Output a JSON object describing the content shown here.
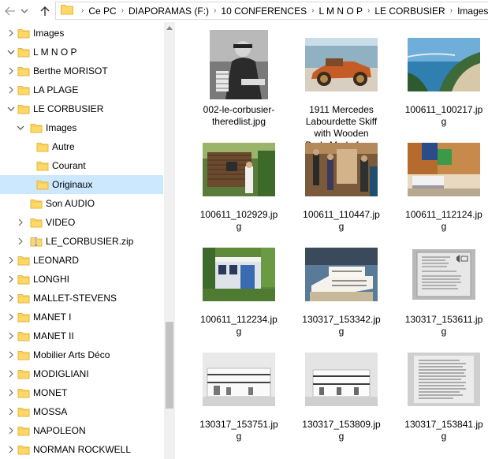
{
  "address": {
    "breadcrumbs": [
      "Ce PC",
      "DIAPORAMAS (F:)",
      "10 CONFERENCES",
      "L M N O P",
      "LE CORBUSIER",
      "Images"
    ]
  },
  "tree": {
    "items": [
      {
        "label": "Images",
        "level": 0,
        "expanded": false,
        "selected": false,
        "type": "folder"
      },
      {
        "label": "L M N O P",
        "level": 0,
        "expanded": true,
        "selected": false,
        "type": "folder"
      },
      {
        "label": "Berthe MORISOT",
        "level": 1,
        "expanded": false,
        "selected": false,
        "type": "folder"
      },
      {
        "label": "LA PLAGE",
        "level": 1,
        "expanded": false,
        "selected": false,
        "type": "folder"
      },
      {
        "label": "LE CORBUSIER",
        "level": 1,
        "expanded": true,
        "selected": false,
        "type": "folder"
      },
      {
        "label": "Images",
        "level": 2,
        "expanded": true,
        "selected": false,
        "type": "folder"
      },
      {
        "label": "Autre",
        "level": 3,
        "expanded": null,
        "selected": false,
        "type": "folder"
      },
      {
        "label": "Courant",
        "level": 3,
        "expanded": null,
        "selected": false,
        "type": "folder"
      },
      {
        "label": "Originaux",
        "level": 3,
        "expanded": null,
        "selected": true,
        "type": "folder"
      },
      {
        "label": "Son AUDIO",
        "level": 2,
        "expanded": null,
        "selected": false,
        "type": "folder"
      },
      {
        "label": "VIDEO",
        "level": 2,
        "expanded": false,
        "selected": false,
        "type": "folder"
      },
      {
        "label": "LE_CORBUSIER.zip",
        "level": 2,
        "expanded": false,
        "selected": false,
        "type": "zip"
      },
      {
        "label": "LEONARD",
        "level": 1,
        "expanded": false,
        "selected": false,
        "type": "folder"
      },
      {
        "label": "LONGHI",
        "level": 1,
        "expanded": false,
        "selected": false,
        "type": "folder"
      },
      {
        "label": "MALLET-STEVENS",
        "level": 1,
        "expanded": false,
        "selected": false,
        "type": "folder"
      },
      {
        "label": "MANET I",
        "level": 1,
        "expanded": false,
        "selected": false,
        "type": "folder"
      },
      {
        "label": "MANET II",
        "level": 1,
        "expanded": false,
        "selected": false,
        "type": "folder"
      },
      {
        "label": "Mobilier Arts Déco",
        "level": 1,
        "expanded": false,
        "selected": false,
        "type": "folder"
      },
      {
        "label": "MODIGLIANI",
        "level": 1,
        "expanded": false,
        "selected": false,
        "type": "folder"
      },
      {
        "label": "MONET",
        "level": 1,
        "expanded": false,
        "selected": false,
        "type": "folder"
      },
      {
        "label": "MOSSA",
        "level": 1,
        "expanded": false,
        "selected": false,
        "type": "folder"
      },
      {
        "label": "NAPOLEON",
        "level": 1,
        "expanded": false,
        "selected": false,
        "type": "folder"
      },
      {
        "label": "NORMAN ROCKWELL",
        "level": 1,
        "expanded": false,
        "selected": false,
        "type": "folder"
      }
    ]
  },
  "files": [
    {
      "name": "002-le-corbusier-theredlist.jpg",
      "lines": [
        "002-le-corbusier-",
        "theredlist.jpg"
      ],
      "thumb": "portrait-bw"
    },
    {
      "name": "1911 Mercedes Labourdette Skiff with Wooden Body Made for ...",
      "lines": [
        "1911 Mercedes",
        "Labourdette Skiff",
        "with Wooden",
        "Body Made for ..."
      ],
      "thumb": "vintage-car"
    },
    {
      "name": "100611_100217.jpg",
      "lines": [
        "100611_100217.jp",
        "g"
      ],
      "thumb": "coast"
    },
    {
      "name": "100611_102929.jpg",
      "lines": [
        "100611_102929.jp",
        "g"
      ],
      "thumb": "cabin"
    },
    {
      "name": "100611_110447.jpg",
      "lines": [
        "100611_110447.jp",
        "g"
      ],
      "thumb": "interior-people"
    },
    {
      "name": "100611_112124.jpg",
      "lines": [
        "100611_112124.jp",
        "g"
      ],
      "thumb": "interior-room"
    },
    {
      "name": "100611_112234.jpg",
      "lines": [
        "100611_112234.jp",
        "g"
      ],
      "thumb": "garden-house"
    },
    {
      "name": "130317_153342.jpg",
      "lines": [
        "130317_153342.jp",
        "g"
      ],
      "thumb": "model-house"
    },
    {
      "name": "130317_153611.jpg",
      "lines": [
        "130317_153611.jp",
        "g"
      ],
      "thumb": "plaque"
    },
    {
      "name": "130317_153751.jpg",
      "lines": [
        "130317_153751.jp",
        "g"
      ],
      "thumb": "model-house-2"
    },
    {
      "name": "130317_153809.jpg",
      "lines": [
        "130317_153809.jp",
        "g"
      ],
      "thumb": "model-house-3"
    },
    {
      "name": "130317_153841.jpg",
      "lines": [
        "130317_153841.jp",
        "g"
      ],
      "thumb": "text-panel"
    }
  ],
  "icons": {
    "back": "arrow-left-icon",
    "forward": "arrow-right-icon",
    "recent": "chevron-down-icon",
    "up": "arrow-up-icon",
    "folder": "folder-icon",
    "zip": "zip-folder-icon"
  },
  "colors": {
    "selection": "#cce8ff",
    "folder": "#ffd867"
  }
}
